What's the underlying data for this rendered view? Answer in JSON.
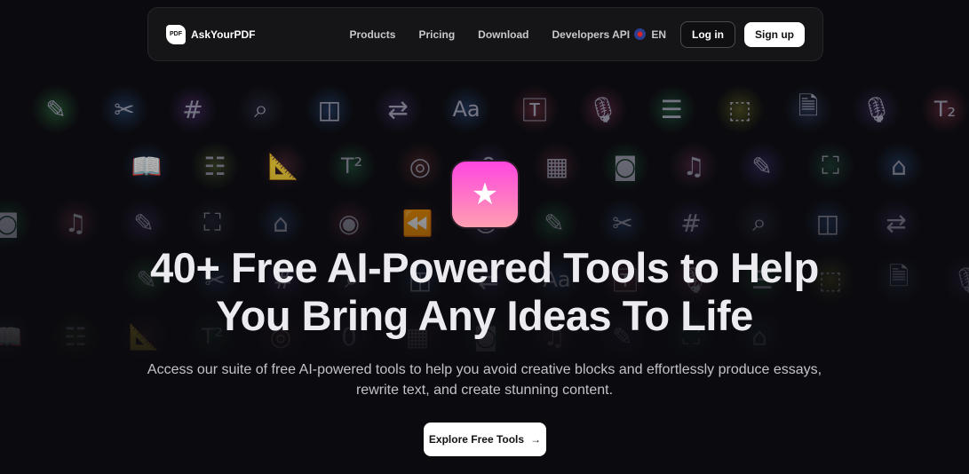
{
  "nav": {
    "brand": "AskYourPDF",
    "logo_text": "PDF",
    "links": [
      "Products",
      "Pricing",
      "Download",
      "Developers API"
    ],
    "language": "EN",
    "login": "Log in",
    "signup": "Sign up"
  },
  "hero": {
    "title_line1": "40+ Free AI-Powered Tools to Help",
    "title_line2": "You Bring Any Ideas To Life",
    "subtitle_line1": "Access our suite of free AI-powered tools to help you avoid creative blocks and effortlessly produce essays,",
    "subtitle_line2": "rewrite text, and create stunning content.",
    "cta": "Explore Free Tools",
    "app_icon": "magic-wand-star-icon"
  },
  "background_icons": {
    "rows": [
      [
        [
          "pencil",
          "✎",
          "#2a6a3a"
        ],
        [
          "tools",
          "✂",
          "#24406a"
        ],
        [
          "hash",
          "#",
          "#4a2a6a"
        ],
        [
          "search",
          "⌕",
          "#2a2a40"
        ],
        [
          "layout",
          "◫",
          "#24406a"
        ],
        [
          "repeat",
          "⇄",
          "#3a2a5a"
        ],
        [
          "font",
          "Aa",
          "#24406a"
        ],
        [
          "text-box",
          "🅃",
          "#6a2a3a"
        ],
        [
          "mic",
          "🎙",
          "#6a2a4a"
        ],
        [
          "list",
          "☰",
          "#1f5a3a"
        ],
        [
          "vector",
          "⬚",
          "#5a5a20"
        ],
        [
          "document",
          "🗎",
          "#2a3a5a"
        ],
        [
          "mic",
          "🎙",
          "#3a2a5a"
        ],
        [
          "subscript",
          "T₂",
          "#6a2a3a"
        ]
      ],
      [
        [
          "book",
          "📖",
          "#24406a"
        ],
        [
          "form",
          "☷",
          "#4a5a2a"
        ],
        [
          "ruler",
          "📐",
          "#5a2a3a"
        ],
        [
          "superscript",
          "T²",
          "#1f5a3a"
        ],
        [
          "target",
          "◎",
          "#5a2a2a"
        ],
        [
          "zero",
          "0",
          "#3a2a5a"
        ],
        [
          "calculator",
          "▦",
          "#5a2a3a"
        ],
        [
          "instagram",
          "◙",
          "#1f5a3a"
        ],
        [
          "music-list",
          "♫",
          "#5a2a4a"
        ],
        [
          "pencil",
          "✎",
          "#3a2a6a"
        ],
        [
          "scan",
          "⛶",
          "#1f4a3a"
        ],
        [
          "id",
          "⌂",
          "#24406a"
        ]
      ],
      [
        [
          "instagram",
          "◙",
          "#1f5a3a"
        ],
        [
          "music-list",
          "♫",
          "#5a2a3a"
        ],
        [
          "pencil",
          "✎",
          "#3a2a5a"
        ],
        [
          "scan",
          "⛶",
          "#2a2a40"
        ],
        [
          "id",
          "⌂",
          "#24406a"
        ],
        [
          "eye",
          "◉",
          "#5a2a3a"
        ],
        [
          "rewind",
          "⏪",
          "#5a2a2a"
        ],
        [
          "discord",
          "☺",
          "#3a2a5a"
        ],
        [
          "pencil",
          "✎",
          "#1f5a3a"
        ],
        [
          "tools",
          "✂",
          "#24406a"
        ],
        [
          "hash",
          "#",
          "#3a2a5a"
        ],
        [
          "search",
          "⌕",
          "#2a2a40"
        ],
        [
          "layout",
          "◫",
          "#24406a"
        ],
        [
          "repeat",
          "⇄",
          "#3a2a5a"
        ]
      ]
    ]
  }
}
